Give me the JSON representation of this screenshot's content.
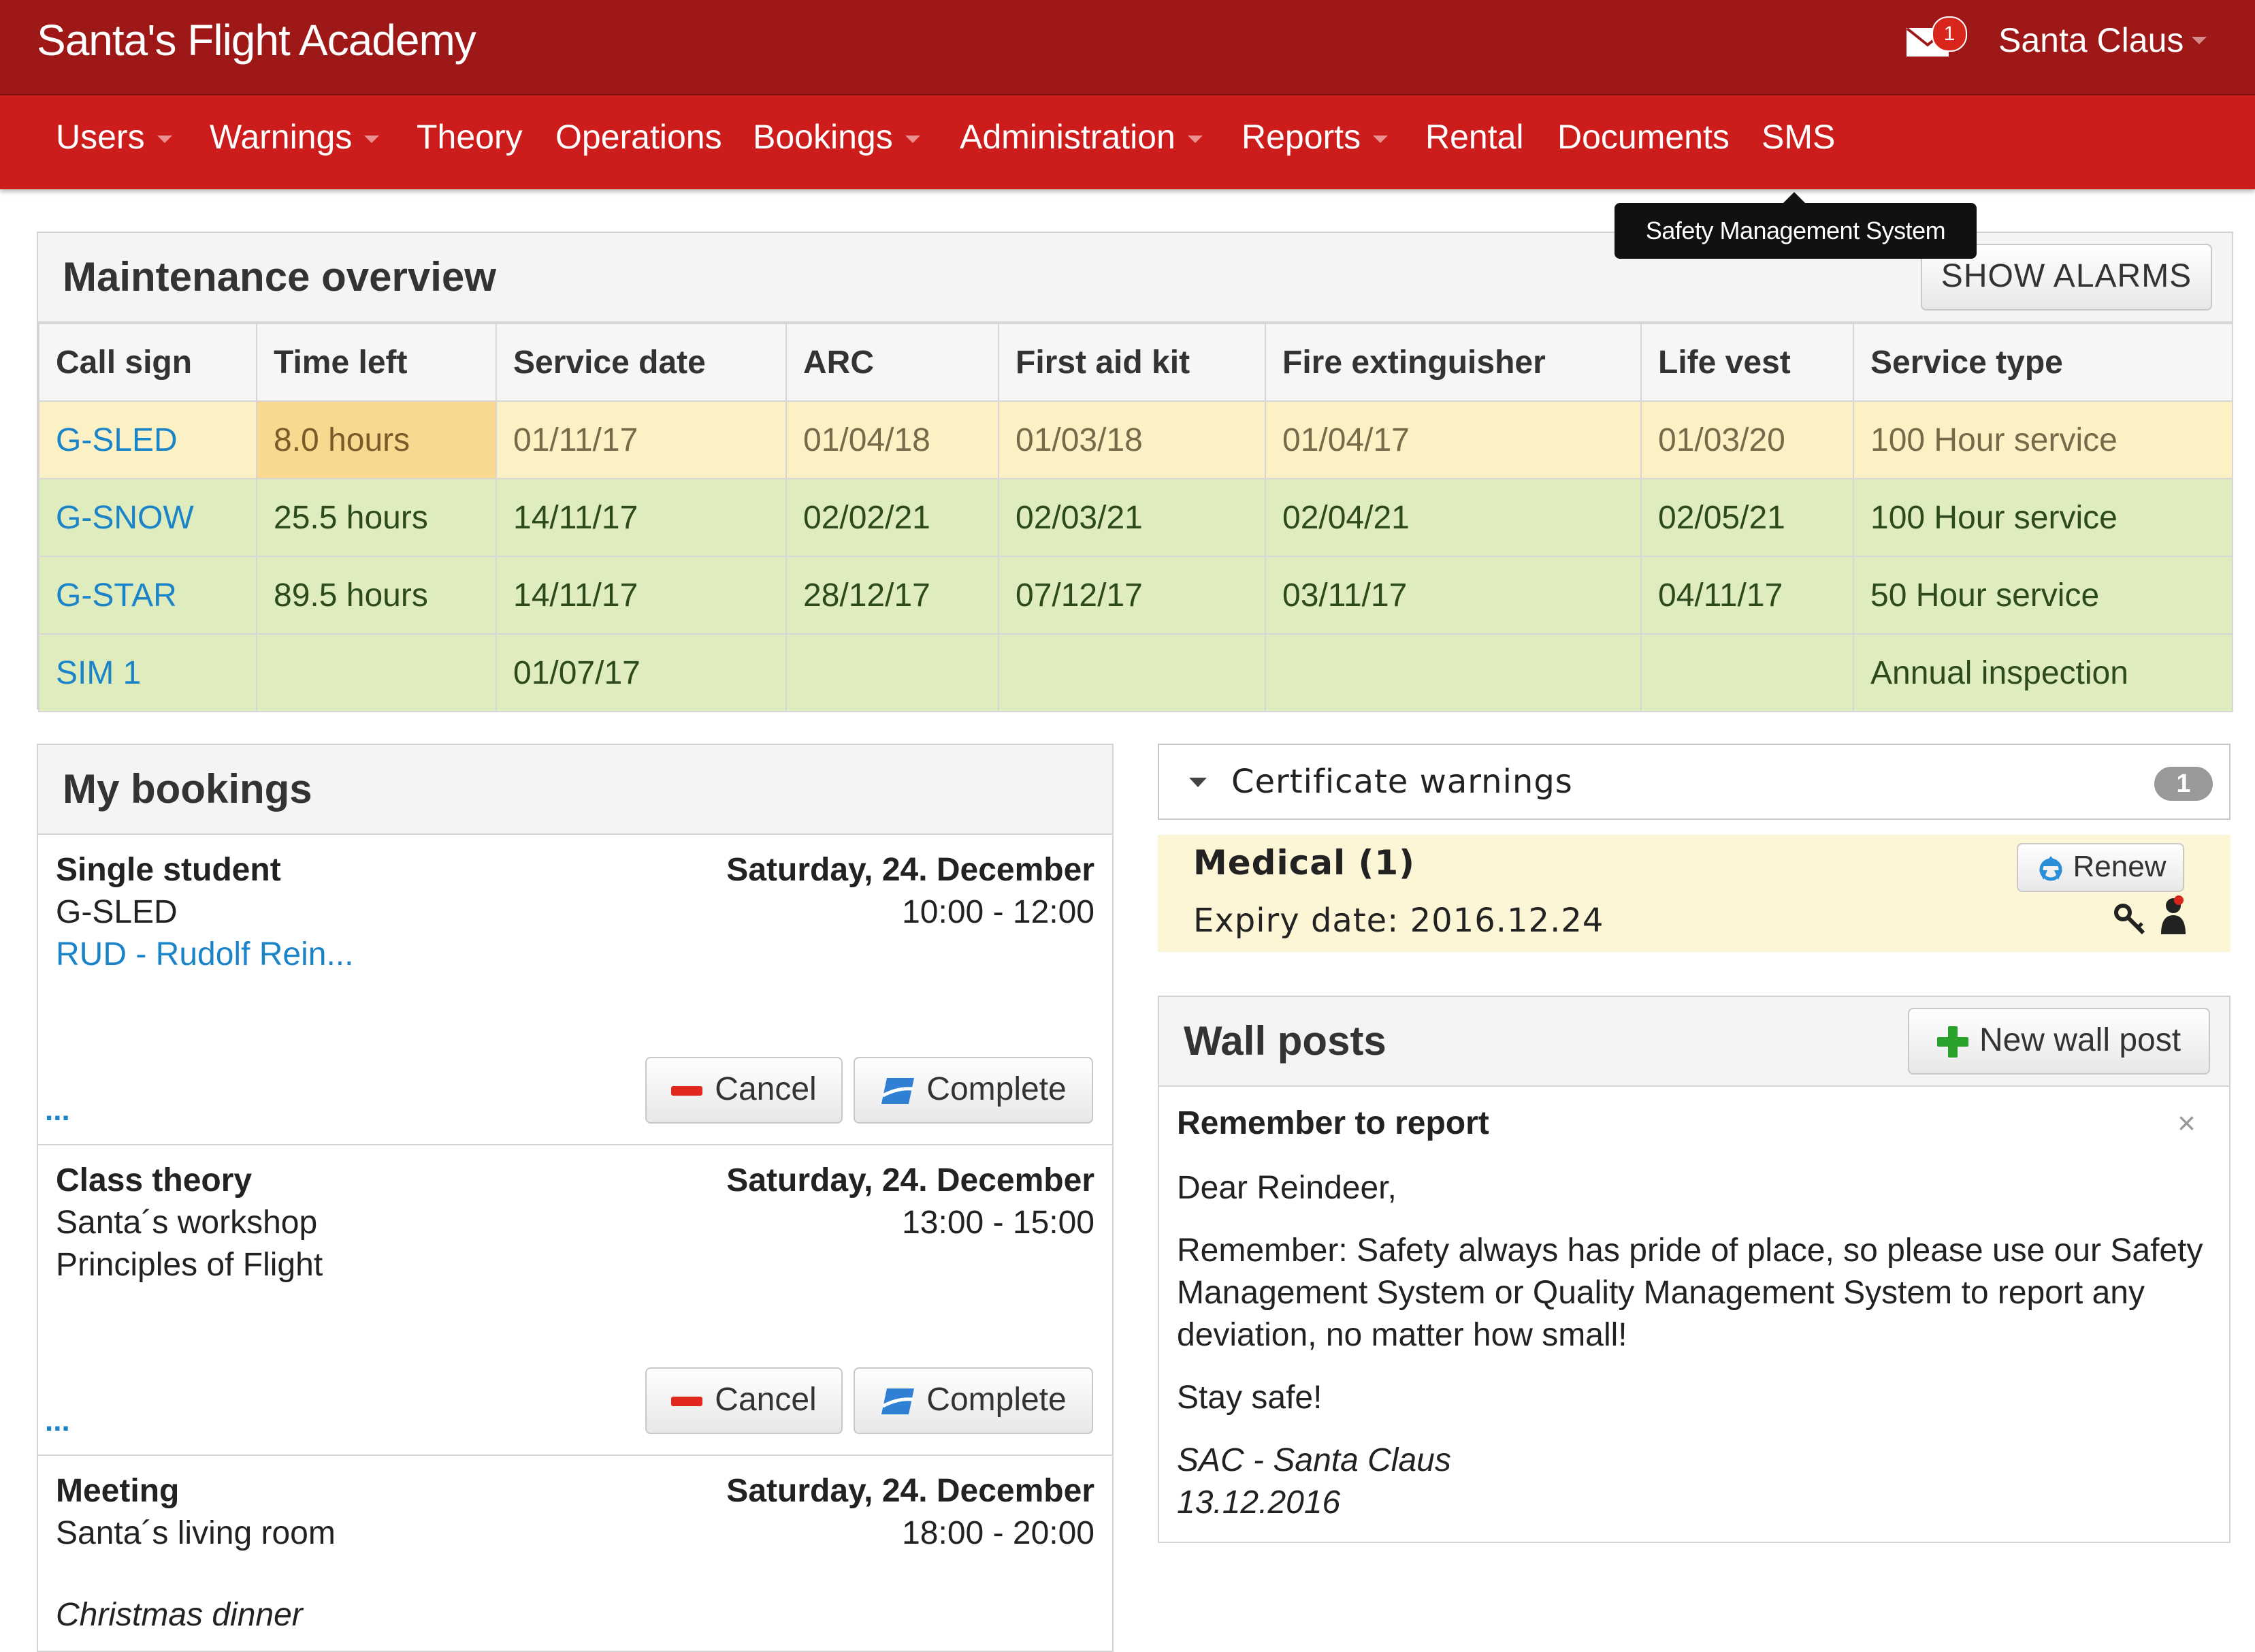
{
  "header": {
    "brand": "Santa's Flight Academy",
    "mail_count": "1",
    "user_name": "Santa Claus"
  },
  "nav": {
    "items": [
      {
        "label": "Users",
        "has_dropdown": true
      },
      {
        "label": "Warnings",
        "has_dropdown": true
      },
      {
        "label": "Theory",
        "has_dropdown": false
      },
      {
        "label": "Operations",
        "has_dropdown": false
      },
      {
        "label": "Bookings",
        "has_dropdown": true
      },
      {
        "label": "Administration",
        "has_dropdown": true
      },
      {
        "label": "Reports",
        "has_dropdown": true
      },
      {
        "label": "Rental",
        "has_dropdown": false
      },
      {
        "label": "Documents",
        "has_dropdown": false
      },
      {
        "label": "SMS",
        "has_dropdown": false
      }
    ],
    "tooltip": "Safety Management System"
  },
  "maintenance": {
    "title": "Maintenance overview",
    "show_alarms_label": "SHOW ALARMS",
    "columns": [
      "Call sign",
      "Time left",
      "Service date",
      "ARC",
      "First aid kit",
      "Fire extinguisher",
      "Life vest",
      "Service type"
    ],
    "rows": [
      {
        "status": "warning",
        "cells": [
          "G-SLED",
          "8.0 hours",
          "01/11/17",
          "01/04/18",
          "01/03/18",
          "01/04/17",
          "01/03/20",
          "100 Hour service"
        ]
      },
      {
        "status": "ok",
        "cells": [
          "G-SNOW",
          "25.5 hours",
          "14/11/17",
          "02/02/21",
          "02/03/21",
          "02/04/21",
          "02/05/21",
          "100 Hour service"
        ]
      },
      {
        "status": "ok",
        "cells": [
          "G-STAR",
          "89.5 hours",
          "14/11/17",
          "28/12/17",
          "07/12/17",
          "03/11/17",
          "04/11/17",
          "50 Hour service"
        ]
      },
      {
        "status": "ok",
        "cells": [
          "SIM 1",
          "",
          "01/07/17",
          "",
          "",
          "",
          "",
          "Annual inspection"
        ]
      }
    ]
  },
  "bookings": {
    "title": "My bookings",
    "items": [
      {
        "type": "Single student",
        "line2": "G-SLED",
        "line3": "RUD - Rudolf Rein...",
        "date": "Saturday, 24. December",
        "time": "10:00 - 12:00",
        "more": "...",
        "cancel_label": "Cancel",
        "complete_label": "Complete"
      },
      {
        "type": "Class theory",
        "line2": "Santa´s workshop",
        "line3": "Principles of Flight",
        "date": "Saturday, 24. December",
        "time": "13:00 - 15:00",
        "more": "...",
        "cancel_label": "Cancel",
        "complete_label": "Complete"
      },
      {
        "type": "Meeting",
        "line2": "Santa´s living room",
        "line3": "Christmas dinner",
        "date": "Saturday, 24. December",
        "time": "18:00 - 20:00"
      }
    ]
  },
  "certificates": {
    "title": "Certificate warnings",
    "count": "1",
    "item": {
      "name": "Medical (1)",
      "expiry": "Expiry date: 2016.12.24",
      "renew_label": "Renew"
    }
  },
  "wall": {
    "title": "Wall posts",
    "new_post_label": "New wall post",
    "post": {
      "title": "Remember to report",
      "close": "×",
      "greeting": "Dear Reindeer,",
      "body": "Remember: Safety always has pride of place, so please use our Safety Management System or Quality Management System to report any deviation, no matter how small!",
      "signoff": "Stay safe!",
      "author": "SAC - Santa Claus",
      "date": "13.12.2016"
    }
  },
  "colors": {
    "header_bg": "#9e1818",
    "nav_bg": "#cd1c1c",
    "warning_row": "#fcf1c4",
    "ok_row": "#dfecbe",
    "highlight_cell": "#f9d98f",
    "link": "#1b84c9"
  },
  "icons": [
    "mail-icon",
    "chevron-down-icon",
    "minus-icon",
    "complete-icon",
    "recycle-icon",
    "key-icon",
    "person-icon",
    "plus-icon",
    "close-icon"
  ]
}
